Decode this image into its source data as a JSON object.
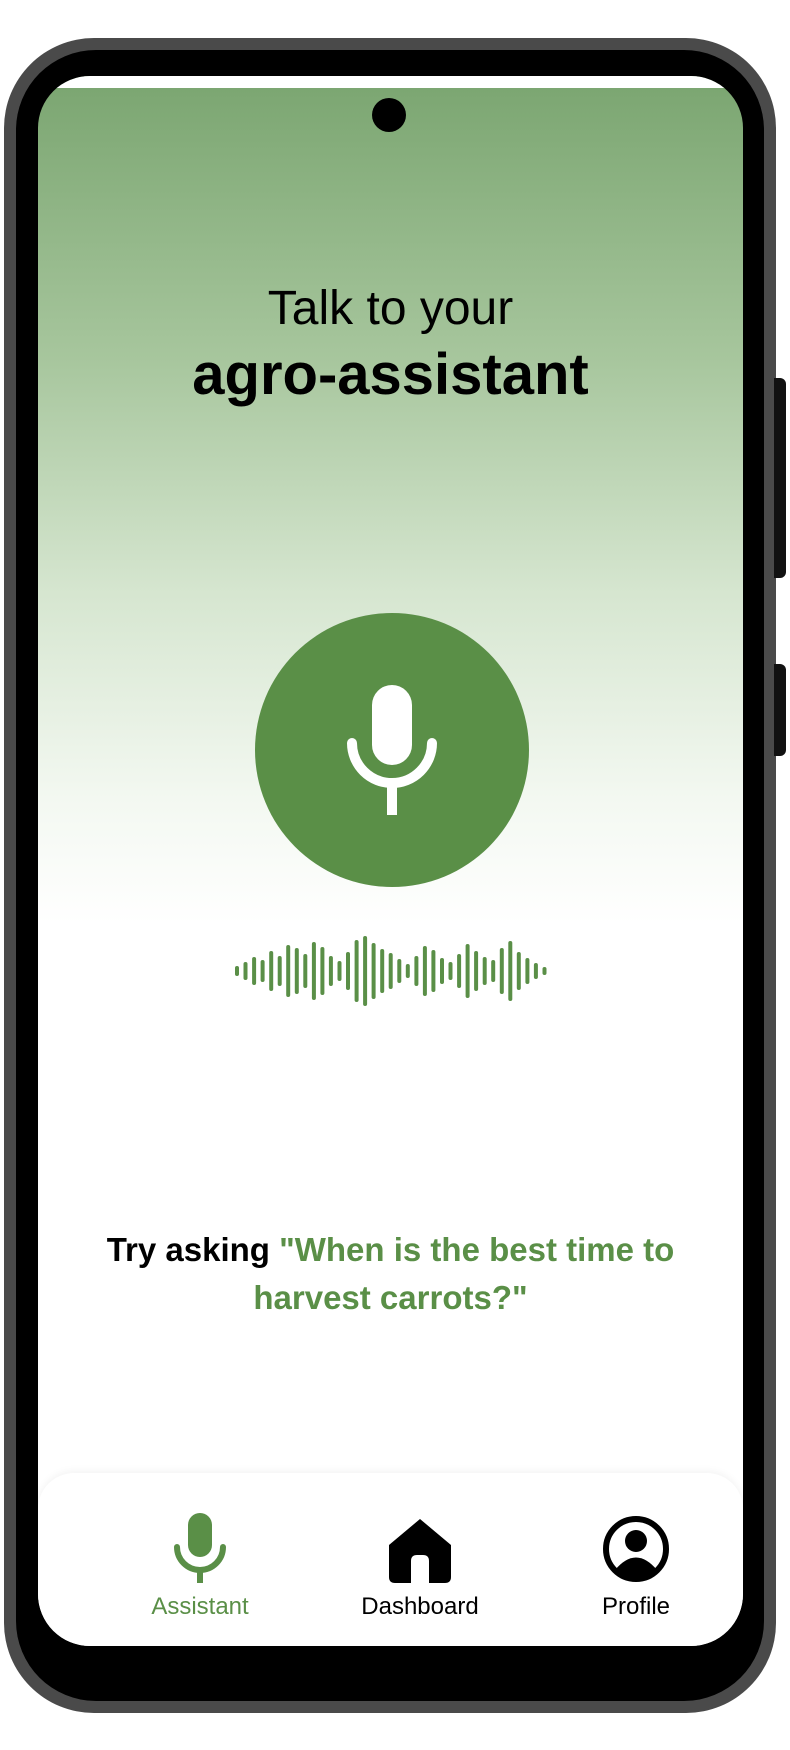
{
  "header": {
    "title_line1": "Talk to your",
    "title_line2": "agro-assistant"
  },
  "mic_button": {
    "icon": "microphone-icon"
  },
  "waveform": {
    "icon": "sound-wave-icon"
  },
  "hint": {
    "prefix": "Try asking ",
    "example": "\"When is the best time to harvest carrots?\""
  },
  "bottom_nav": {
    "items": [
      {
        "label": "Assistant",
        "icon": "microphone-icon",
        "active": true
      },
      {
        "label": "Dashboard",
        "icon": "home-icon",
        "active": false
      },
      {
        "label": "Profile",
        "icon": "user-circle-icon",
        "active": false
      }
    ]
  },
  "colors": {
    "accent": "#5a8f47",
    "header_gradient_top": "#7aa570",
    "text": "#000000",
    "nav_background": "#ffffff"
  }
}
